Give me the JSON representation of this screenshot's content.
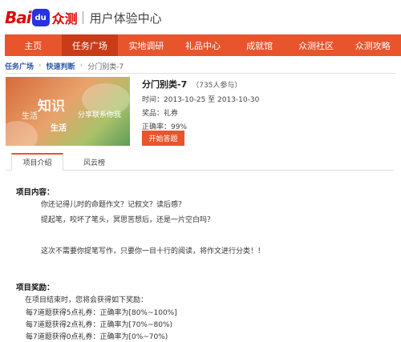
{
  "header": {
    "logo_bai": "Bai",
    "logo_du": "du",
    "logo_zc": "众测",
    "title": "用户体验中心"
  },
  "nav": {
    "items": [
      "主页",
      "任务广场",
      "实地调研",
      "礼品中心",
      "成就馆",
      "众测社区",
      "众测攻略"
    ],
    "active_index": 1
  },
  "breadcrumb": [
    "任务广场",
    "快速判断",
    "分门别类-7"
  ],
  "task": {
    "thumb_text": [
      "知识",
      "生活",
      "分享联系你我",
      "生活"
    ],
    "title": "分门别类-7",
    "participants": "（735人参与）",
    "time": "时间：2013-10-25 至 2013-10-30",
    "reward": "奖品：礼券",
    "accuracy": "正确率：99%",
    "start_label": "开始答题"
  },
  "tabs": [
    "项目介绍",
    "风云榜"
  ],
  "content": {
    "section1_title": "项目内容：",
    "line1": "你还记得儿时的命题作文？记叙文？读后感？",
    "line2": "提起笔，咬坏了笔头，冥思苦想后，还是一片空白吗？",
    "line3": "这次不需要你提笔写作，只要你一目十行的阅读，将作文进行分类！！",
    "section2_title": "项目奖励：",
    "reward_intro": "在项目结束时，您将会获得如下奖励：",
    "rewards": [
      "每7道题获得5点礼券：正确率为[80%~100%]",
      "每7道题获得2点礼券：正确率为[70%~80%)",
      "每7道题获得0点礼券：正确率为[0%~70%)"
    ]
  },
  "colors": {
    "brand_red": "#e10601",
    "nav_orange": "#e8542c",
    "nav_active": "#c93c18",
    "link_blue": "#2b57a4"
  }
}
